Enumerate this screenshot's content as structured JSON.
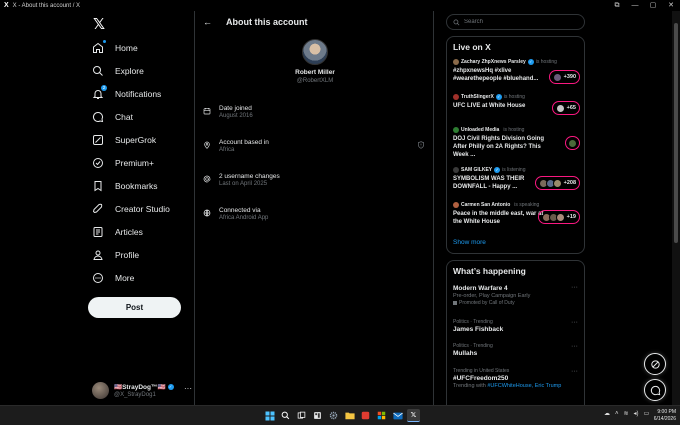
{
  "window": {
    "title": "X - About this account / X",
    "app_icon": "X"
  },
  "colors": {
    "accent": "#1d9bf0",
    "live_ring": "#f91880",
    "background": "#000000",
    "border": "#2f3336",
    "muted_text": "#71767b"
  },
  "sidebar": {
    "logo": "𝕏",
    "items": [
      {
        "label": "Home",
        "icon": "home-icon"
      },
      {
        "label": "Explore",
        "icon": "search-icon"
      },
      {
        "label": "Notifications",
        "icon": "bell-icon",
        "badge": "2"
      },
      {
        "label": "Chat",
        "icon": "chat-icon"
      },
      {
        "label": "SuperGrok",
        "icon": "grok-icon"
      },
      {
        "label": "Premium+",
        "icon": "premium-icon"
      },
      {
        "label": "Bookmarks",
        "icon": "bookmark-icon"
      },
      {
        "label": "Creator Studio",
        "icon": "rocket-icon"
      },
      {
        "label": "Articles",
        "icon": "article-icon"
      },
      {
        "label": "Profile",
        "icon": "profile-icon"
      },
      {
        "label": "More",
        "icon": "more-circle-icon"
      }
    ],
    "post_label": "Post",
    "account": {
      "display_name": "🇺🇸StrayDog™🇺🇸",
      "handle": "@X_StrayDog1",
      "more": "···"
    }
  },
  "main": {
    "header_title": "About this account",
    "profile": {
      "name": "Robert Miller",
      "handle": "@RobertXLM"
    },
    "rows": [
      {
        "title": "Date joined",
        "value": "August 2016",
        "icon": "calendar-icon"
      },
      {
        "title": "Account based in",
        "value": "Africa",
        "icon": "location-icon"
      },
      {
        "title": "2 username changes",
        "value": "Last on April 2025",
        "icon": "at-icon"
      },
      {
        "title": "Connected via",
        "value": "Africa Android App",
        "icon": "globe-icon"
      }
    ]
  },
  "right": {
    "search_placeholder": "Search",
    "live": {
      "title": "Live on X",
      "items": [
        {
          "host": "Zachary ZhpXnews Parsley",
          "status": "is hosting",
          "title": "#zhpxnewsHq #xlive #wearethepeople #bluehand...",
          "count": "+390"
        },
        {
          "host": "TruthSlingerX",
          "status": "is hosting",
          "title": "UFC LIVE at White House",
          "count": "+65"
        },
        {
          "host": "Unloaded Media",
          "status": "is hosting",
          "title": "DOJ Civil Rights Division Going After Philly on 2A Rights? This Week ...",
          "count": ""
        },
        {
          "host": "SAM GILKEY",
          "status": "is listening",
          "title": "SYMBOLISM WAS THEIR DOWNFALL - Happy ...",
          "count": "+208"
        },
        {
          "host": "Carmen San Antonio",
          "status": "is speaking",
          "title": "Peace in the middle east, war at the White House",
          "count": "+19"
        }
      ],
      "show_more": "Show more"
    },
    "happening": {
      "title": "What’s happening",
      "trends": [
        {
          "context": "",
          "title": "Modern Warfare 4",
          "sub": "Pre-order, Play Campaign Early",
          "promo": "Promoted by Call of Duty"
        },
        {
          "context": "Politics · Trending",
          "title": "James Fishback",
          "sub": "",
          "promo": ""
        },
        {
          "context": "Politics · Trending",
          "title": "Mullahs",
          "sub": "",
          "promo": ""
        },
        {
          "context": "Trending in United States",
          "title": "#UFCFreedom250",
          "sub": "Trending with",
          "links": "#UFCWhiteHouse, Eric Trump",
          "promo": ""
        }
      ]
    }
  },
  "taskbar": {
    "time": "9:00 PM",
    "date": "6/14/2026"
  }
}
